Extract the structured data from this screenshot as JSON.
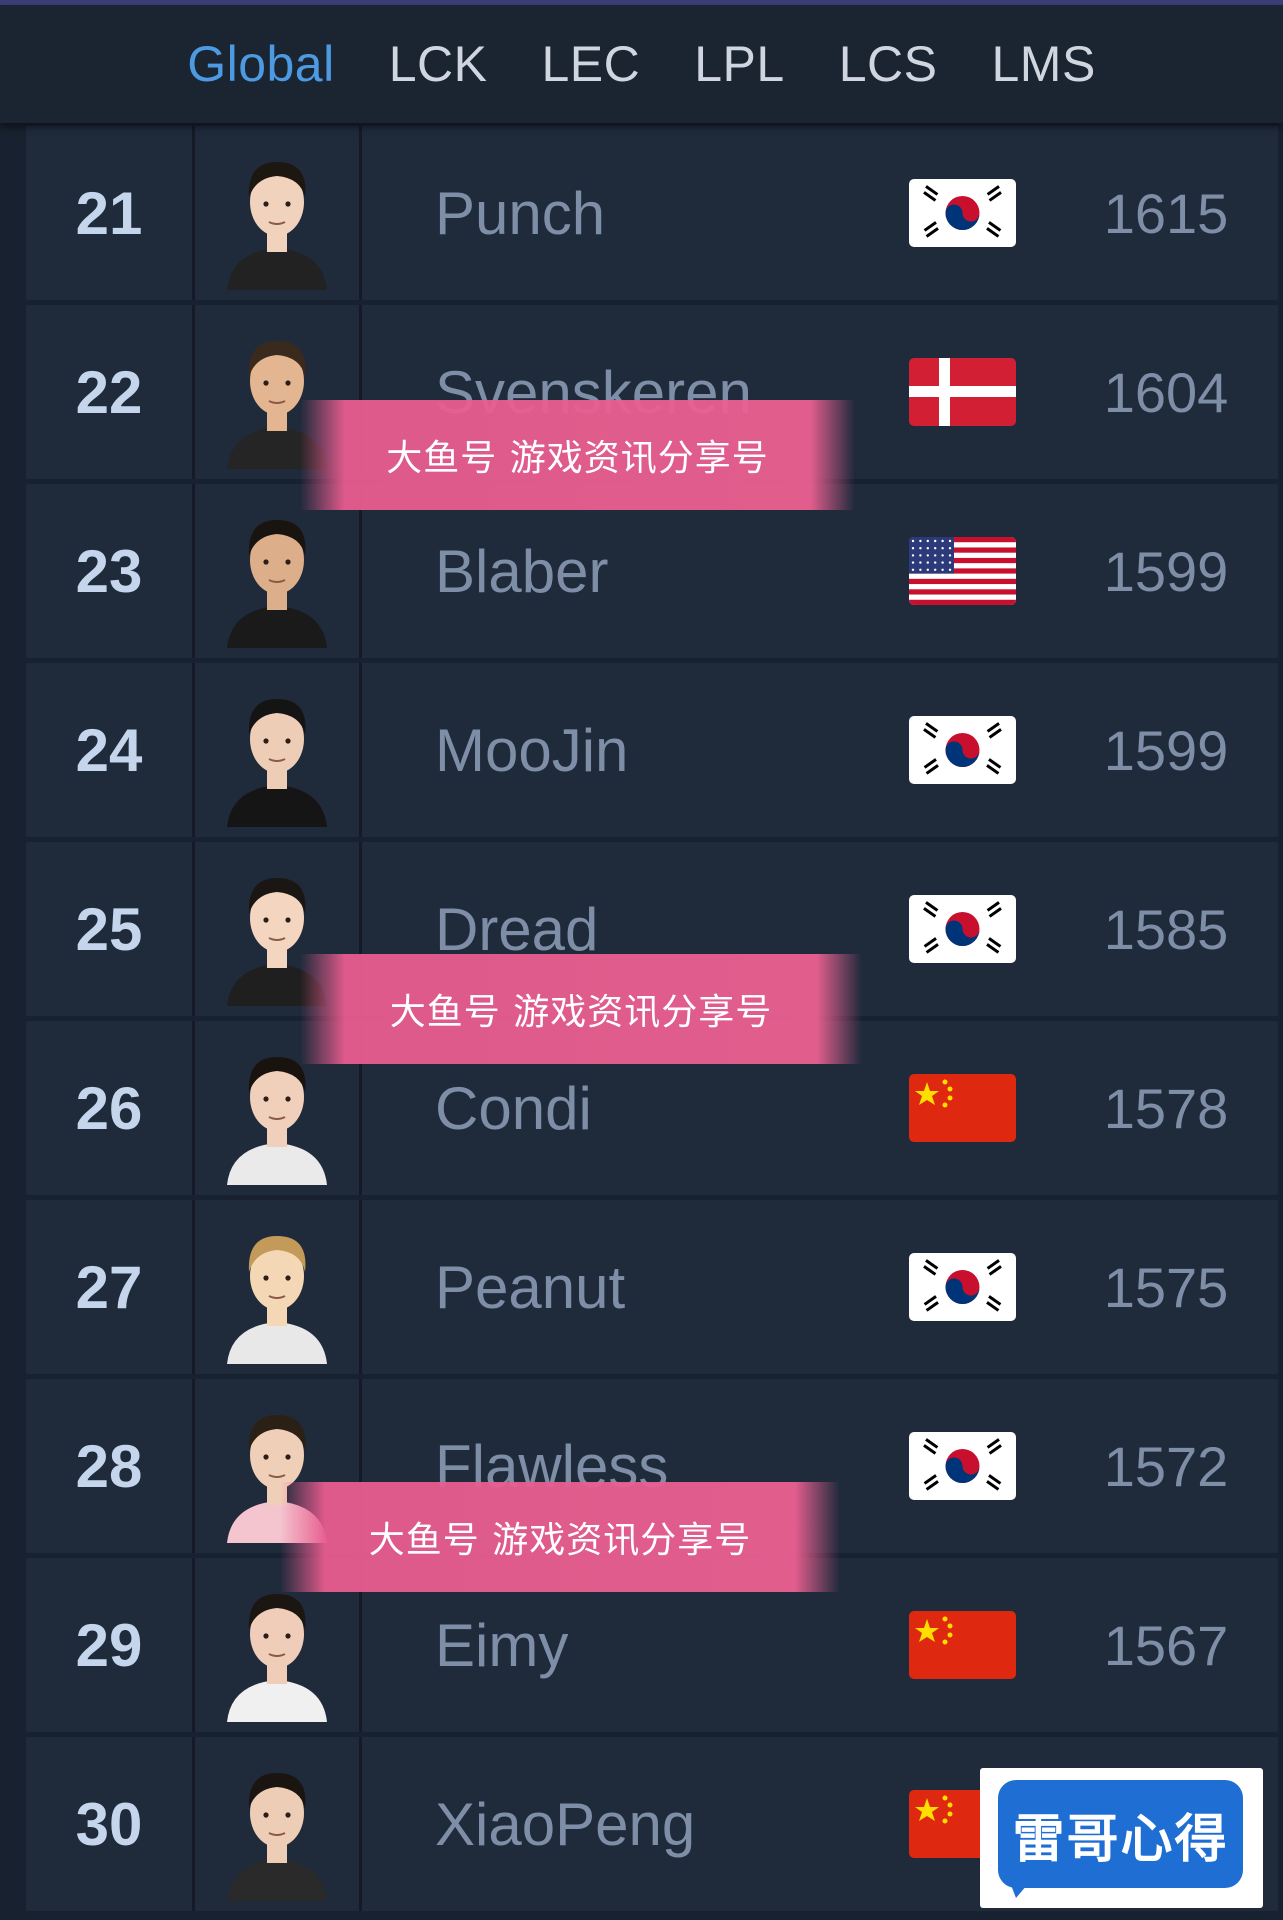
{
  "tabs": [
    {
      "label": "Global",
      "active": true
    },
    {
      "label": "LCK",
      "active": false
    },
    {
      "label": "LEC",
      "active": false
    },
    {
      "label": "LPL",
      "active": false
    },
    {
      "label": "LCS",
      "active": false
    },
    {
      "label": "LMS",
      "active": false
    }
  ],
  "players": [
    {
      "rank": "21",
      "name": "Punch",
      "flag": "korea-flag-icon",
      "rating": "1615"
    },
    {
      "rank": "22",
      "name": "Svenskeren",
      "flag": "denmark-flag-icon",
      "rating": "1604"
    },
    {
      "rank": "23",
      "name": "Blaber",
      "flag": "usa-flag-icon",
      "rating": "1599"
    },
    {
      "rank": "24",
      "name": "MooJin",
      "flag": "korea-flag-icon",
      "rating": "1599"
    },
    {
      "rank": "25",
      "name": "Dread",
      "flag": "korea-flag-icon",
      "rating": "1585"
    },
    {
      "rank": "26",
      "name": "Condi",
      "flag": "china-flag-icon",
      "rating": "1578"
    },
    {
      "rank": "27",
      "name": "Peanut",
      "flag": "korea-flag-icon",
      "rating": "1575"
    },
    {
      "rank": "28",
      "name": "Flawless",
      "flag": "korea-flag-icon",
      "rating": "1572"
    },
    {
      "rank": "29",
      "name": "Eimy",
      "flag": "china-flag-icon",
      "rating": "1567"
    },
    {
      "rank": "30",
      "name": "XiaoPeng",
      "flag": "china-flag-icon",
      "rating": ""
    }
  ],
  "watermarks": [
    {
      "text": "大鱼号 游戏资讯分享号"
    },
    {
      "text": "大鱼号 游戏资讯分享号"
    },
    {
      "text": "大鱼号 游戏资讯分享号"
    }
  ],
  "logo": {
    "text": "雷哥心得"
  },
  "colors": {
    "background": "#18212f",
    "row": "#1f2a3b",
    "active_tab": "#4d9ae2",
    "rank_text": "#c4d5ec",
    "muted_text": "#7f8ea7",
    "watermark": "#eb6091",
    "logo_blue": "#1e6ed3"
  }
}
